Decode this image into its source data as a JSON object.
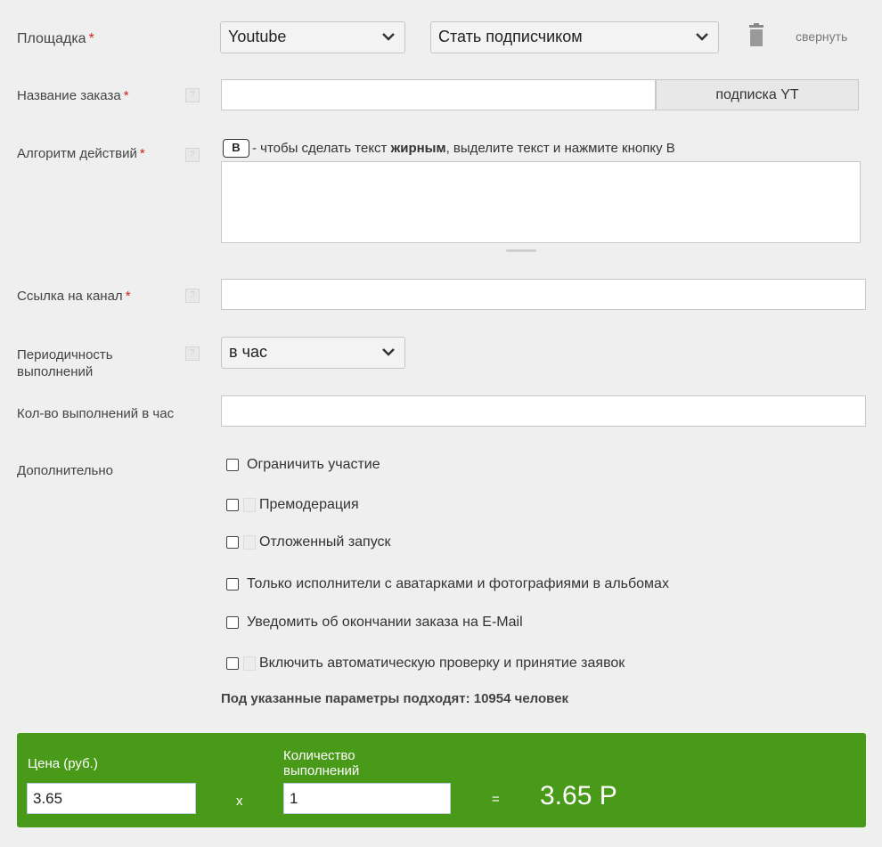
{
  "platform": {
    "label": "Площадка",
    "required_mark": "*",
    "selected": "Youtube",
    "action_selected": "Стать подписчиком",
    "collapse_label": "свернуть"
  },
  "order_name": {
    "label": "Название заказа",
    "required_mark": "*",
    "value": "",
    "preset_button": "подписка YT"
  },
  "algorithm": {
    "label": "Алгоритм действий",
    "required_mark": "*",
    "bold_button": "B",
    "hint_prefix": " - чтобы сделать текст ",
    "hint_bold": "жирным",
    "hint_suffix": ", выделите текст и нажмите кнопку B",
    "value": ""
  },
  "channel_link": {
    "label": "Ссылка на канал",
    "required_mark": "*",
    "value": ""
  },
  "frequency": {
    "label": "Периодичность выполнений",
    "selected": "в час"
  },
  "count_per_hour": {
    "label": "Кол-во выполнений в час",
    "value": ""
  },
  "extra": {
    "label": "Дополнительно",
    "options": [
      {
        "label": "Ограничить участие",
        "checked": false,
        "help": false
      },
      {
        "label": "Премодерация",
        "checked": false,
        "help": true
      },
      {
        "label": "Отложенный запуск",
        "checked": false,
        "help": true
      },
      {
        "label": "Только исполнители с аватарками и фотографиями в альбомах",
        "checked": false,
        "help": false
      },
      {
        "label": "Уведомить об окончании заказа на E-Mail",
        "checked": false,
        "help": false
      },
      {
        "label": "Включить автоматическую проверку и принятие заявок",
        "checked": false,
        "help": true
      }
    ],
    "matching_text": "Под указанные параметры подходят: 10954 человек"
  },
  "price": {
    "price_label": "Цена (руб.)",
    "price_value": "3.65",
    "multiply": "x",
    "qty_label": "Количество выполнений",
    "qty_value": "1",
    "equals": "=",
    "total": "3.65 Р"
  },
  "colors": {
    "accent_green": "#4a9a1a",
    "required_red": "#cc2222",
    "background": "#efefef"
  }
}
